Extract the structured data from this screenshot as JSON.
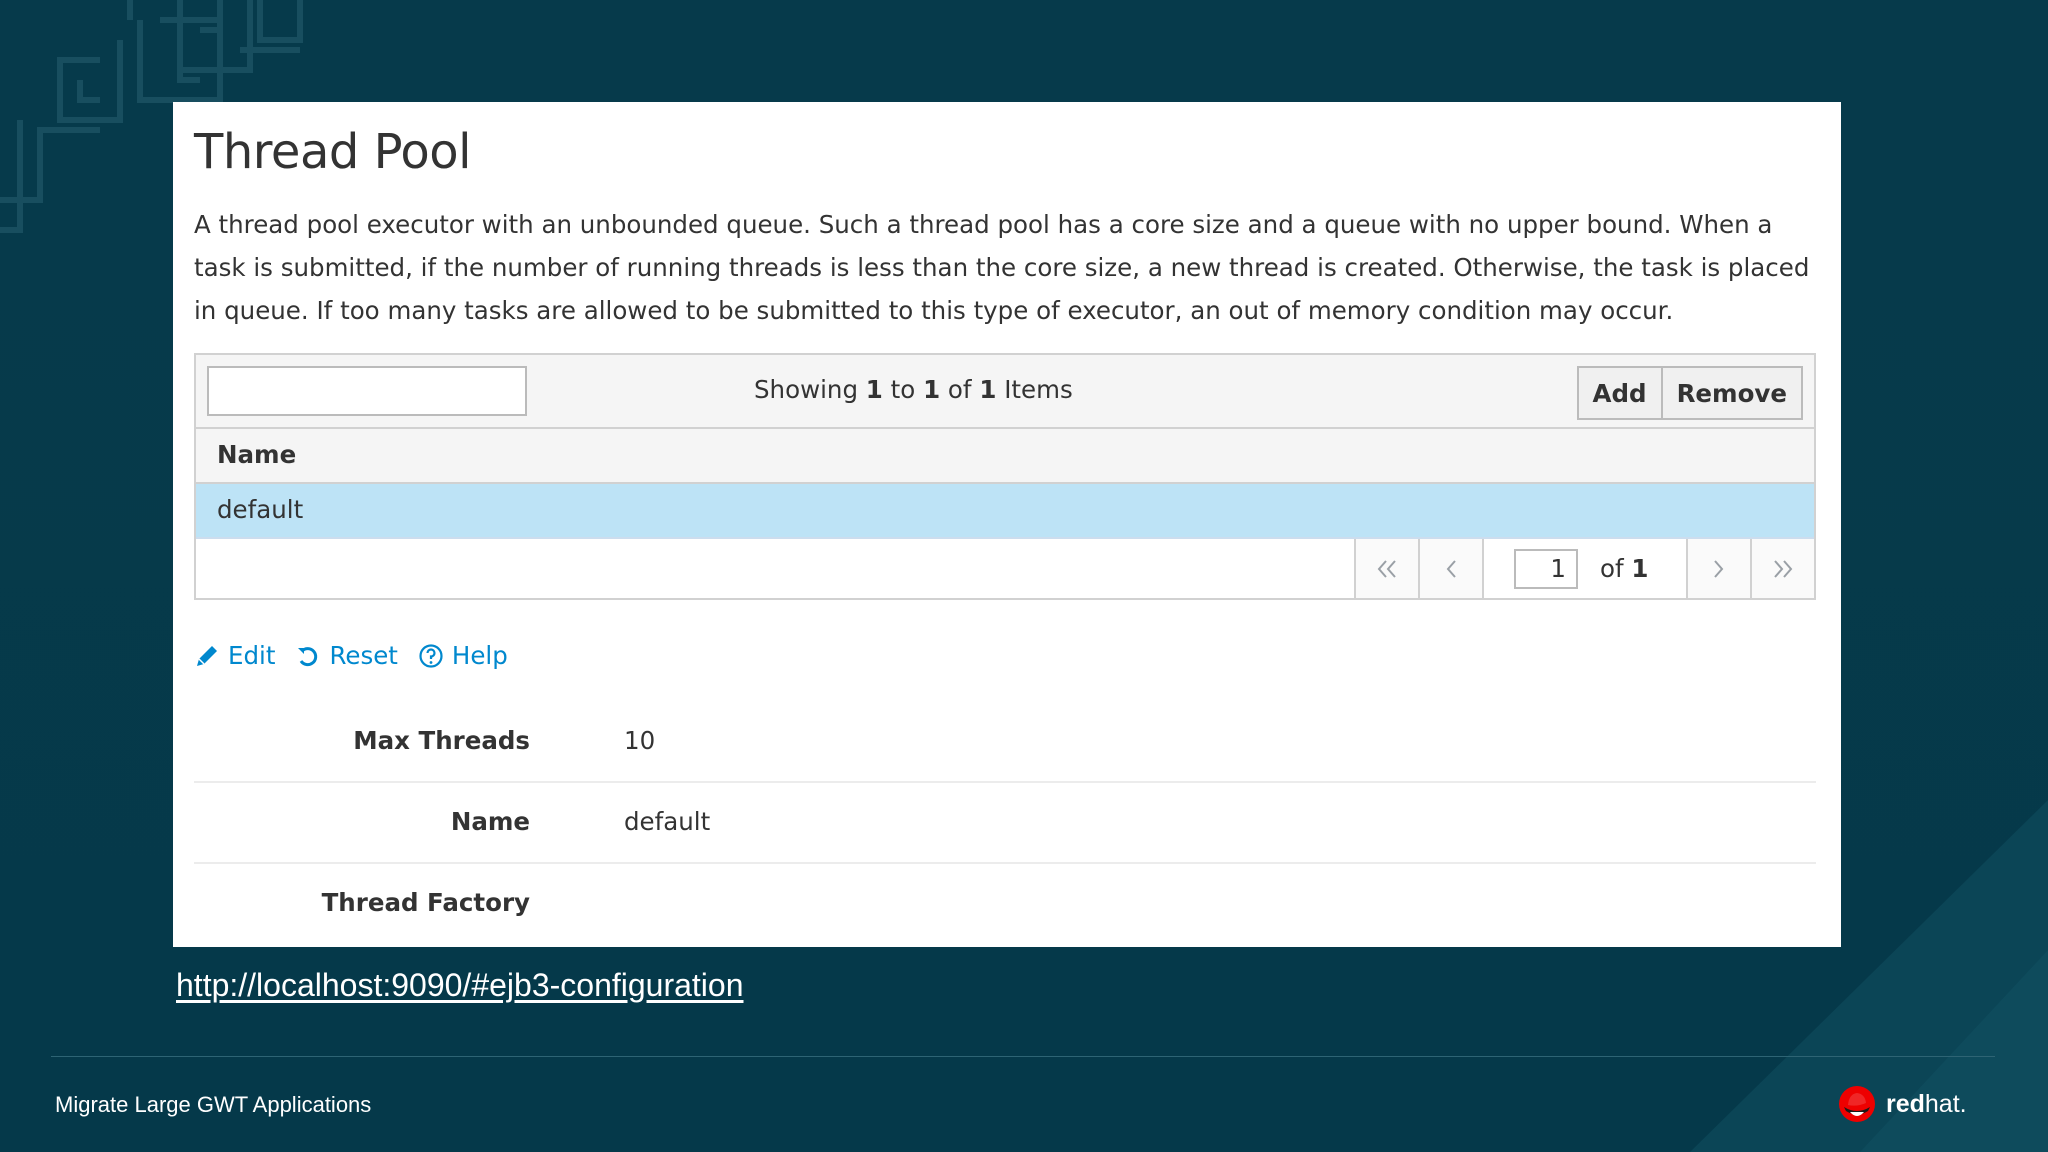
{
  "panel": {
    "title": "Thread Pool",
    "description": "A thread pool executor with an unbounded queue. Such a thread pool has a core size and a queue with no upper bound. When a task is submitted, if the number of running threads is less than the core size, a new thread is created. Otherwise, the task is placed in queue. If too many tasks are allowed to be submitted to this type of executor, an out of memory condition may occur."
  },
  "table": {
    "filter_value": "",
    "showing": {
      "prefix": "Showing",
      "from": "1",
      "to_word": "to",
      "to": "1",
      "of_word": "of",
      "total": "1",
      "suffix": "Items"
    },
    "buttons": {
      "add": "Add",
      "remove": "Remove"
    },
    "column_header": "Name",
    "rows": [
      {
        "name": "default",
        "selected": true
      }
    ],
    "pager": {
      "current_page": "1",
      "of_word": "of",
      "total_pages": "1"
    }
  },
  "actions": {
    "edit": "Edit",
    "reset": "Reset",
    "help": "Help"
  },
  "attributes": [
    {
      "label": "Max Threads",
      "value": "10"
    },
    {
      "label": "Name",
      "value": "default"
    },
    {
      "label": "Thread Factory",
      "value": ""
    }
  ],
  "url": "http://localhost:9090/#ejb3-configuration",
  "footer": {
    "title": "Migrate Large GWT Applications",
    "brand_bold": "red",
    "brand_light": "hat."
  },
  "colors": {
    "background": "#063a4b",
    "link": "#0088ce",
    "selected_row": "#bde3f6",
    "brand_red": "#ee0000"
  }
}
